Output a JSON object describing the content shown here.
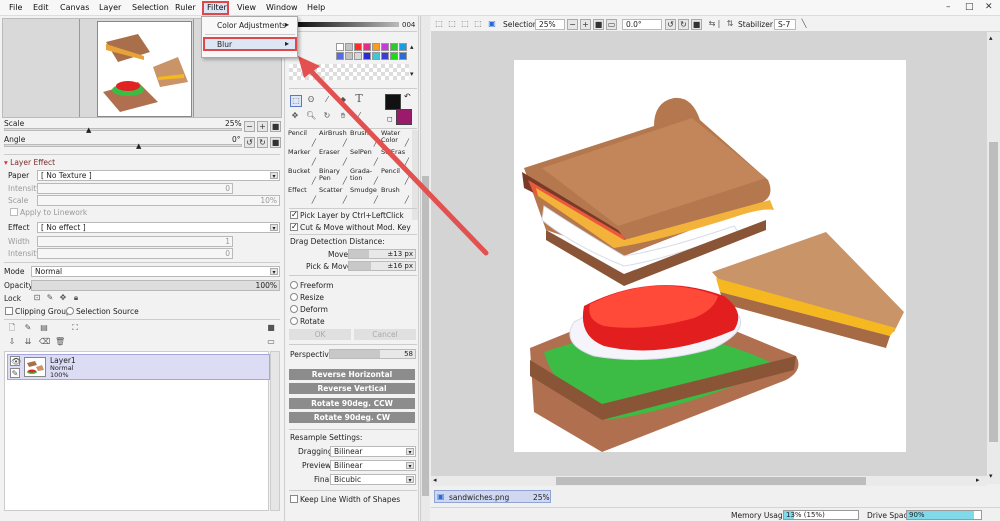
{
  "menubar": {
    "items": [
      "File",
      "Edit",
      "Canvas",
      "Layer",
      "Selection",
      "Ruler",
      "Filter",
      "View",
      "Window",
      "Help"
    ],
    "window_controls": [
      "–",
      "□",
      "✕"
    ]
  },
  "filter_menu": {
    "items": [
      {
        "label": "Color Adjustments",
        "arrow": "▸"
      },
      {
        "label": "Blur",
        "arrow": "▸"
      }
    ]
  },
  "navigator": {
    "scale_label": "Scale",
    "scale_value": "25%",
    "angle_label": "Angle",
    "angle_value": "0°"
  },
  "layer_effect": {
    "title": "Layer Effect",
    "paper_label": "Paper",
    "paper_value": "[ No Texture ]",
    "intensity_label": "Intensity",
    "intensity_value": "0",
    "scale_label": "Scale",
    "scale_value": "10%",
    "apply_linework": "Apply to Linework",
    "effect_label": "Effect",
    "effect_value": "[ No effect ]",
    "width_label": "Width",
    "width_value": "1",
    "intensity2_label": "Intensity",
    "intensity2_value": "0"
  },
  "layer_props": {
    "mode_label": "Mode",
    "mode_value": "Normal",
    "opacity_label": "Opacity",
    "opacity_value": "100%",
    "opacity_fraction": 1.0,
    "lock_label": "Lock",
    "clipping_group": "Clipping Group",
    "selection_source": "Selection Source"
  },
  "layers": [
    {
      "name": "Layer1",
      "mode": "Normal",
      "opacity": "100%"
    }
  ],
  "color_panel": {
    "hex_value": "004",
    "primary_color": "#111111",
    "secondary_color": "#9b1a6e",
    "swatches": [
      "#ffffff",
      "#c2c2c2",
      "#ff2a2a",
      "#e62b8a",
      "#ff9a1a",
      "#c43bd9",
      "#2ec82e",
      "#1a9be6",
      "#5a6be0",
      "#c2c2c2",
      "#d8d8d8",
      "#2a2ad8",
      "#3cc8d8",
      "#3c3cd8",
      "#1ad81a",
      "#2a6bd8"
    ]
  },
  "tools": {
    "brush_names": [
      "Pencil",
      "AirBrush",
      "Brush",
      "Water Color",
      "Marker",
      "Eraser",
      "SelPen",
      "SelEras",
      "Bucket",
      "Binary Pen",
      "Grada-tion",
      "Pencil",
      "Effect",
      "Scatter",
      "Smudge",
      "Brush"
    ]
  },
  "tool_options": {
    "pick_layer": "Pick Layer by Ctrl+LeftClick",
    "cut_move": "Cut & Move without Mod. Key",
    "drag_detection": "Drag Detection Distance:",
    "move_label": "Move",
    "move_value": "±13 px",
    "pick_move_label": "Pick & Move",
    "pick_move_value": "±16 px",
    "transform_modes": [
      "Freeform",
      "Resize",
      "Deform",
      "Rotate"
    ],
    "ok": "OK",
    "cancel": "Cancel",
    "perspective_label": "Perspective",
    "perspective_value": "58",
    "buttons": [
      "Reverse Horizontal",
      "Reverse Vertical",
      "Rotate 90deg. CCW",
      "Rotate 90deg. CW"
    ],
    "resample_title": "Resample Settings:",
    "dragging_label": "Dragging",
    "dragging_value": "Bilinear",
    "preview_label": "Preview",
    "preview_value": "Bilinear",
    "final_label": "Final",
    "final_value": "Bicubic",
    "keep_line": "Keep Line Width of Shapes"
  },
  "canvas_toolbar": {
    "selection_label": "Selection",
    "zoom_value": "25%",
    "angle_value": "0.0°",
    "stabilizer_label": "Stabilizer",
    "stabilizer_value": "S-7"
  },
  "canvas_tab": {
    "filename": "sandwiches.png",
    "zoom": "25%"
  },
  "status": {
    "memory_label": "Memory Usage",
    "memory_value": "13% (15%)",
    "memory_fraction": 0.13,
    "drive_label": "Drive Space",
    "drive_value": "90%",
    "drive_fraction": 0.9
  }
}
